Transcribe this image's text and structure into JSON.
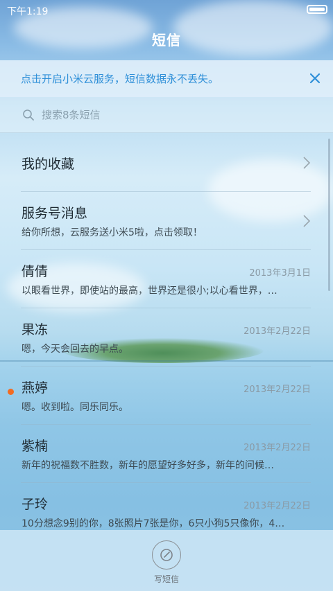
{
  "status_bar": {
    "time": "下午1:19"
  },
  "header": {
    "title": "短信"
  },
  "notice": {
    "text": "点击开启小米云服务，短信数据永不丢失。"
  },
  "search": {
    "placeholder": "搜索8条短信"
  },
  "conversations": [
    {
      "title": "我的收藏",
      "subtitle": "",
      "date": "",
      "chevron": true,
      "unread": false
    },
    {
      "title": "服务号消息",
      "subtitle": "给你所想，云服务送小米5啦，点击领取！",
      "date": "",
      "chevron": true,
      "unread": false
    },
    {
      "title": "倩倩",
      "subtitle": "以眼看世界，即使站的最高，世界还是很小;以心看世界，…",
      "date": "2013年3月1日",
      "chevron": false,
      "unread": false
    },
    {
      "title": "果冻",
      "subtitle": "嗯，今天会回去的早点。",
      "date": "2013年2月22日",
      "chevron": false,
      "unread": false
    },
    {
      "title": "燕婷",
      "subtitle": "嗯。收到啦。同乐同乐。",
      "date": "2013年2月22日",
      "chevron": false,
      "unread": true
    },
    {
      "title": "紫楠",
      "subtitle": "新年的祝福数不胜数，新年的愿望好多好多，新年的问候…",
      "date": "2013年2月22日",
      "chevron": false,
      "unread": false
    },
    {
      "title": "子玲",
      "subtitle": "10分想念9别的你，8张照片7张是你，6只小狗5只像你，4…",
      "date": "2013年2月22日",
      "chevron": false,
      "unread": false
    }
  ],
  "bottom": {
    "compose_label": "写短信"
  },
  "colors": {
    "accent": "#2e8fd8",
    "unread": "#f26b22"
  }
}
